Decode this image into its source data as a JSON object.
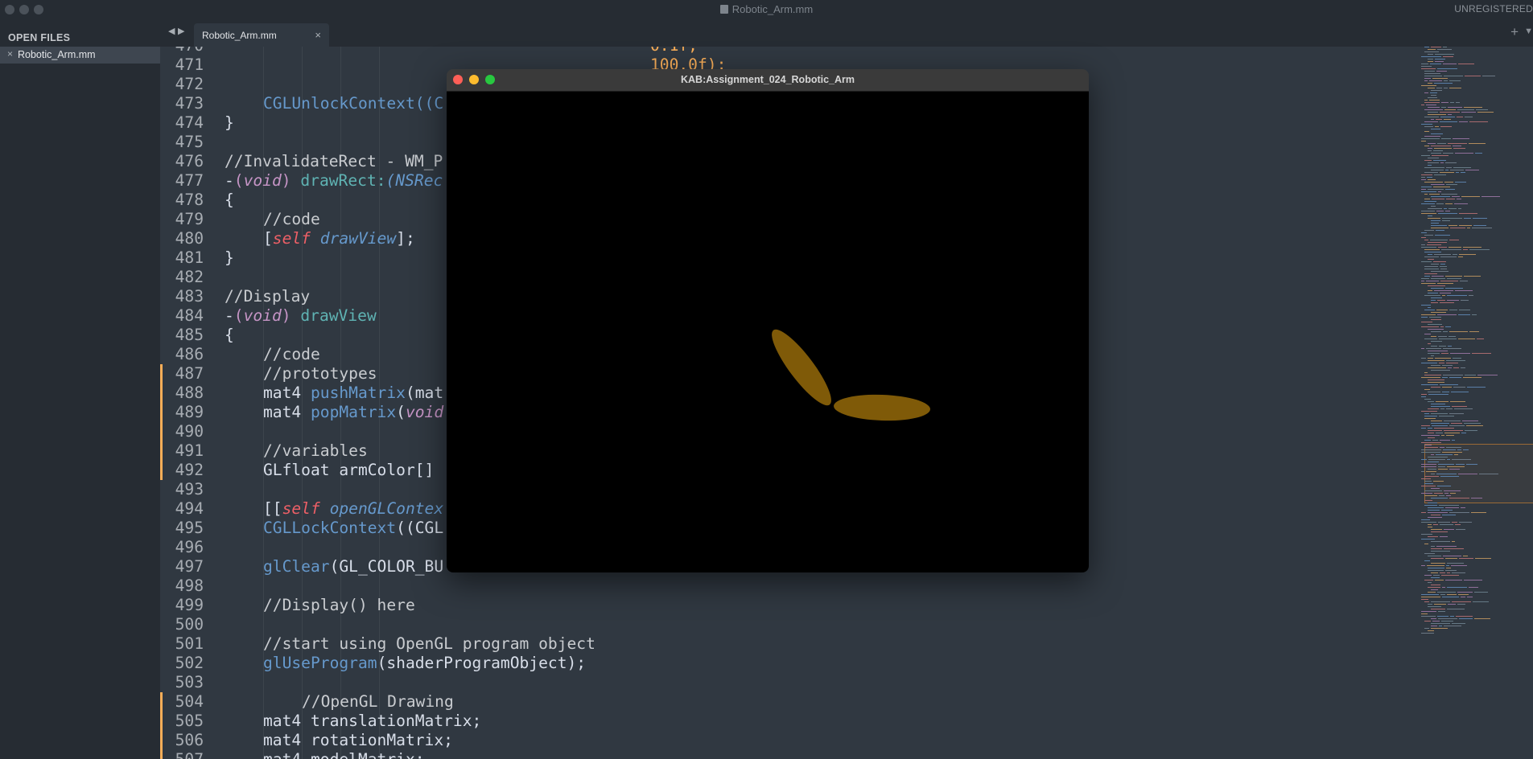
{
  "window": {
    "title": "Robotic_Arm.mm",
    "registration_status": "UNREGISTERED"
  },
  "sidebar": {
    "heading": "OPEN FILES",
    "files": [
      {
        "name": "Robotic_Arm.mm",
        "close_icon": "close-icon"
      }
    ]
  },
  "tabs": {
    "nav_back_icon": "◀",
    "nav_forward_icon": "▶",
    "items": [
      {
        "label": "Robotic_Arm.mm",
        "close": "×"
      }
    ],
    "add_icon": "+",
    "dropdown_icon": "▼"
  },
  "editor": {
    "lines": [
      {
        "n": "470",
        "mod": false
      },
      {
        "n": "471",
        "mod": false
      },
      {
        "n": "472",
        "mod": false
      },
      {
        "n": "473",
        "mod": false
      },
      {
        "n": "474",
        "mod": false
      },
      {
        "n": "475",
        "mod": false
      },
      {
        "n": "476",
        "mod": false
      },
      {
        "n": "477",
        "mod": false
      },
      {
        "n": "478",
        "mod": false
      },
      {
        "n": "479",
        "mod": false
      },
      {
        "n": "480",
        "mod": false
      },
      {
        "n": "481",
        "mod": false
      },
      {
        "n": "482",
        "mod": false
      },
      {
        "n": "483",
        "mod": false
      },
      {
        "n": "484",
        "mod": false
      },
      {
        "n": "485",
        "mod": false
      },
      {
        "n": "486",
        "mod": false
      },
      {
        "n": "487",
        "mod": true
      },
      {
        "n": "488",
        "mod": true
      },
      {
        "n": "489",
        "mod": true
      },
      {
        "n": "490",
        "mod": true
      },
      {
        "n": "491",
        "mod": true
      },
      {
        "n": "492",
        "mod": true
      },
      {
        "n": "493",
        "mod": false
      },
      {
        "n": "494",
        "mod": false
      },
      {
        "n": "495",
        "mod": false
      },
      {
        "n": "496",
        "mod": false
      },
      {
        "n": "497",
        "mod": false
      },
      {
        "n": "498",
        "mod": false
      },
      {
        "n": "499",
        "mod": false
      },
      {
        "n": "500",
        "mod": false
      },
      {
        "n": "501",
        "mod": false
      },
      {
        "n": "502",
        "mod": false
      },
      {
        "n": "503",
        "mod": false
      },
      {
        "n": "504",
        "mod": true
      },
      {
        "n": "505",
        "mod": true
      },
      {
        "n": "506",
        "mod": true
      },
      {
        "n": "507",
        "mod": true
      }
    ],
    "code": {
      "l470": "0.1f,",
      "l471": "100.0f);",
      "l473": "CGLUnlockContext((C",
      "l474": "}",
      "l476": "//InvalidateRect - WM_P",
      "l477_dash": "-",
      "l477_paren": "(",
      "l477_void": "void",
      "l477_close": ")",
      "l477_name": " drawRect:",
      "l477_arg": "(NSRec",
      "l478": "{",
      "l479": "//code",
      "l480_open": "[",
      "l480_self": "self",
      "l480_meth": " drawView",
      "l480_close": "];",
      "l481": "}",
      "l483": "//Display",
      "l484_dash": "-",
      "l484_paren": "(",
      "l484_void": "void",
      "l484_close": ")",
      "l484_name": " drawView",
      "l485": "{",
      "l486": "//code",
      "l487": "//prototypes",
      "l488_type": "mat4 ",
      "l488_func": "pushMatrix",
      "l488_arg": "(mat",
      "l489_type": "mat4 ",
      "l489_func": "popMatrix",
      "l489_paren": "(",
      "l489_arg": "void",
      "l491": "//variables",
      "l492": "GLfloat armColor[]",
      "l494_open": "[[",
      "l494_self": "self",
      "l494_meth": " openGLContex",
      "l495_func": "CGLLockContext",
      "l495_arg": "((CGL",
      "l497_func": "glClear",
      "l497_arg": "(GL_COLOR_BU",
      "l499": "//Display() here",
      "l501": "//start using OpenGL program object",
      "l502_func": "glUseProgram",
      "l502_arg": "(shaderProgramObject);",
      "l504": "//OpenGL Drawing",
      "l505": "mat4 translationMatrix;",
      "l506": "mat4 rotationMatrix;",
      "l507": "mat4 modelMatrix;"
    }
  },
  "gl_window": {
    "title": "KAB:Assignment_024_Robotic_Arm",
    "controls": [
      "close",
      "minimize",
      "zoom"
    ],
    "background_color": "#000000",
    "arm_color": "#7f5a08"
  },
  "colors": {
    "editor_bg": "#303841",
    "sidebar_bg": "#262c33",
    "modified_marker": "#f9ae58"
  }
}
